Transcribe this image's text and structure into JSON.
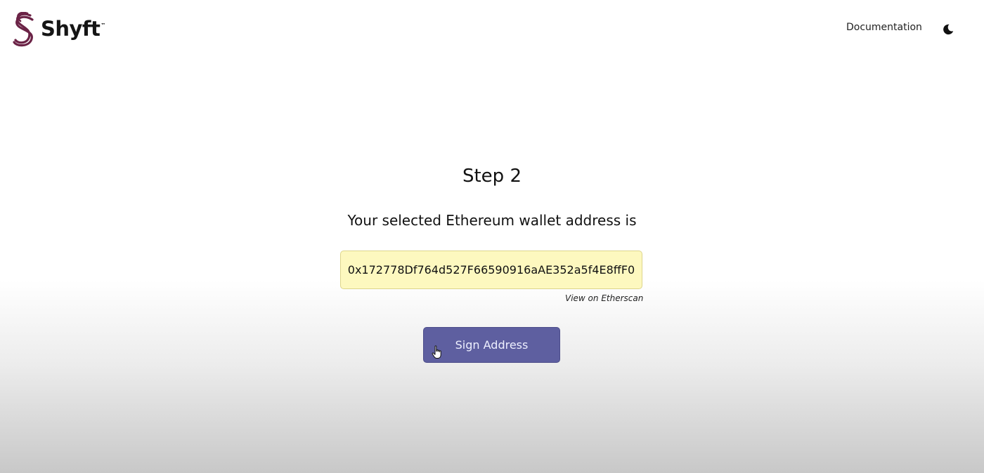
{
  "header": {
    "logo": {
      "icon": "shyft-s-logo-icon",
      "text": "Shyft",
      "trademark": "™",
      "brand_color": "#6b2346"
    },
    "nav": {
      "documentation_label": "Documentation"
    },
    "theme_toggle": {
      "icon": "moon-icon"
    }
  },
  "main": {
    "step_title": "Step 2",
    "subtitle": "Your selected Ethereum wallet address is",
    "wallet_address": "0x172778Df764d527F66590916aAE352a5f4E8ffF0",
    "etherscan_link_label": "View on Etherscan",
    "sign_button_label": "Sign Address",
    "colors": {
      "address_background": "#fdf8bf",
      "address_border": "#ddd58a",
      "button_background": "#5e5fa0"
    }
  },
  "cursor": {
    "icon": "hand-pointer-cursor-icon"
  }
}
